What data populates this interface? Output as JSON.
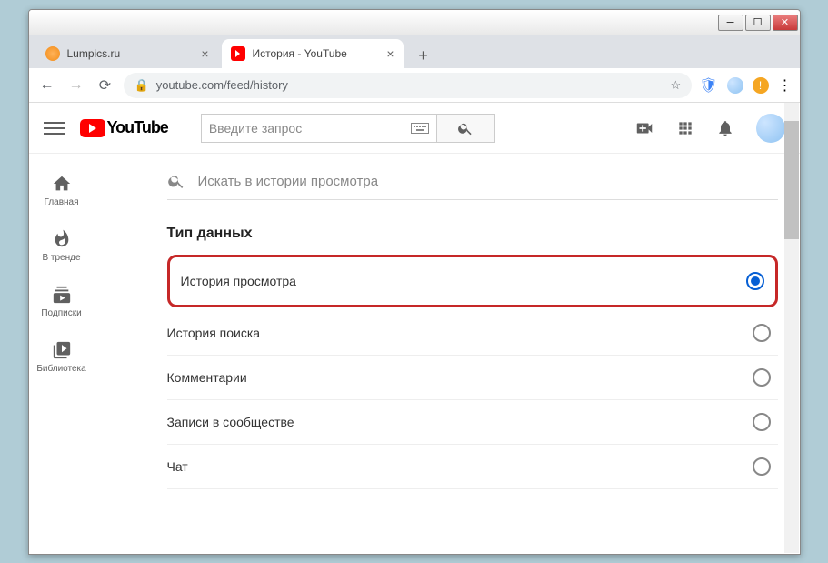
{
  "window_controls": {
    "min": "─",
    "max": "☐",
    "close": "✕"
  },
  "tabs": [
    {
      "title": "Lumpics.ru",
      "active": false
    },
    {
      "title": "История - YouTube",
      "active": true
    }
  ],
  "newtab": "+",
  "nav": {
    "back": "←",
    "forward": "→",
    "reload": "⟳"
  },
  "address": {
    "lock": "🔒",
    "url": "youtube.com/feed/history",
    "star": "☆"
  },
  "omni_icons": {
    "shield": "🛡",
    "menu": "⋮"
  },
  "yt": {
    "logo_text": "YouTube",
    "search_placeholder": "Введите запрос",
    "search_icon": "🔍",
    "upload": "📹",
    "apps": "⋮⋮⋮",
    "bell": "🔔"
  },
  "sidebar": [
    {
      "label": "Главная",
      "icon": "home"
    },
    {
      "label": "В тренде",
      "icon": "trend"
    },
    {
      "label": "Подписки",
      "icon": "subs"
    },
    {
      "label": "Библиотека",
      "icon": "lib"
    }
  ],
  "history_search_placeholder": "Искать в истории просмотра",
  "section_title": "Тип данных",
  "options": [
    {
      "label": "История просмотра",
      "selected": true,
      "highlight": true
    },
    {
      "label": "История поиска",
      "selected": false
    },
    {
      "label": "Комментарии",
      "selected": false
    },
    {
      "label": "Записи в сообществе",
      "selected": false
    },
    {
      "label": "Чат",
      "selected": false
    }
  ]
}
